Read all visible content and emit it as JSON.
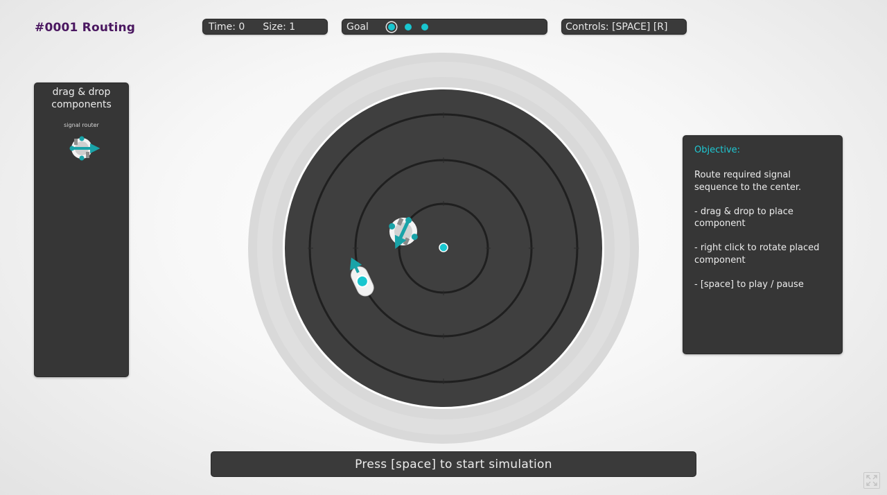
{
  "level": {
    "title": "#0001 Routing"
  },
  "hud": {
    "time_label": "Time: 0",
    "size_label": "Size: 1",
    "goal_label": "Goal",
    "goal_signals": 3,
    "controls_label": "Controls: [SPACE]  [R]"
  },
  "components_panel": {
    "heading_line1": "drag & drop",
    "heading_line2": "components",
    "items": [
      {
        "label": "signal router",
        "icon": "signal-router-icon"
      }
    ]
  },
  "objective": {
    "title": "Objective:",
    "paragraphs": [
      "Route required signal sequence to the center.",
      "- drag & drop to place component",
      "- right click to rotate placed component",
      "- [space] to play / pause"
    ]
  },
  "footer": {
    "status": "Press [space] to start simulation"
  },
  "colors": {
    "accent": "#19c6cf",
    "title": "#4a1760",
    "panel": "#363636",
    "board": "#3f3f3f",
    "ring_track": "#1f1f1f",
    "outer_ring": "#d6d6d6"
  },
  "icons": {
    "fullscreen": "fullscreen-icon"
  }
}
